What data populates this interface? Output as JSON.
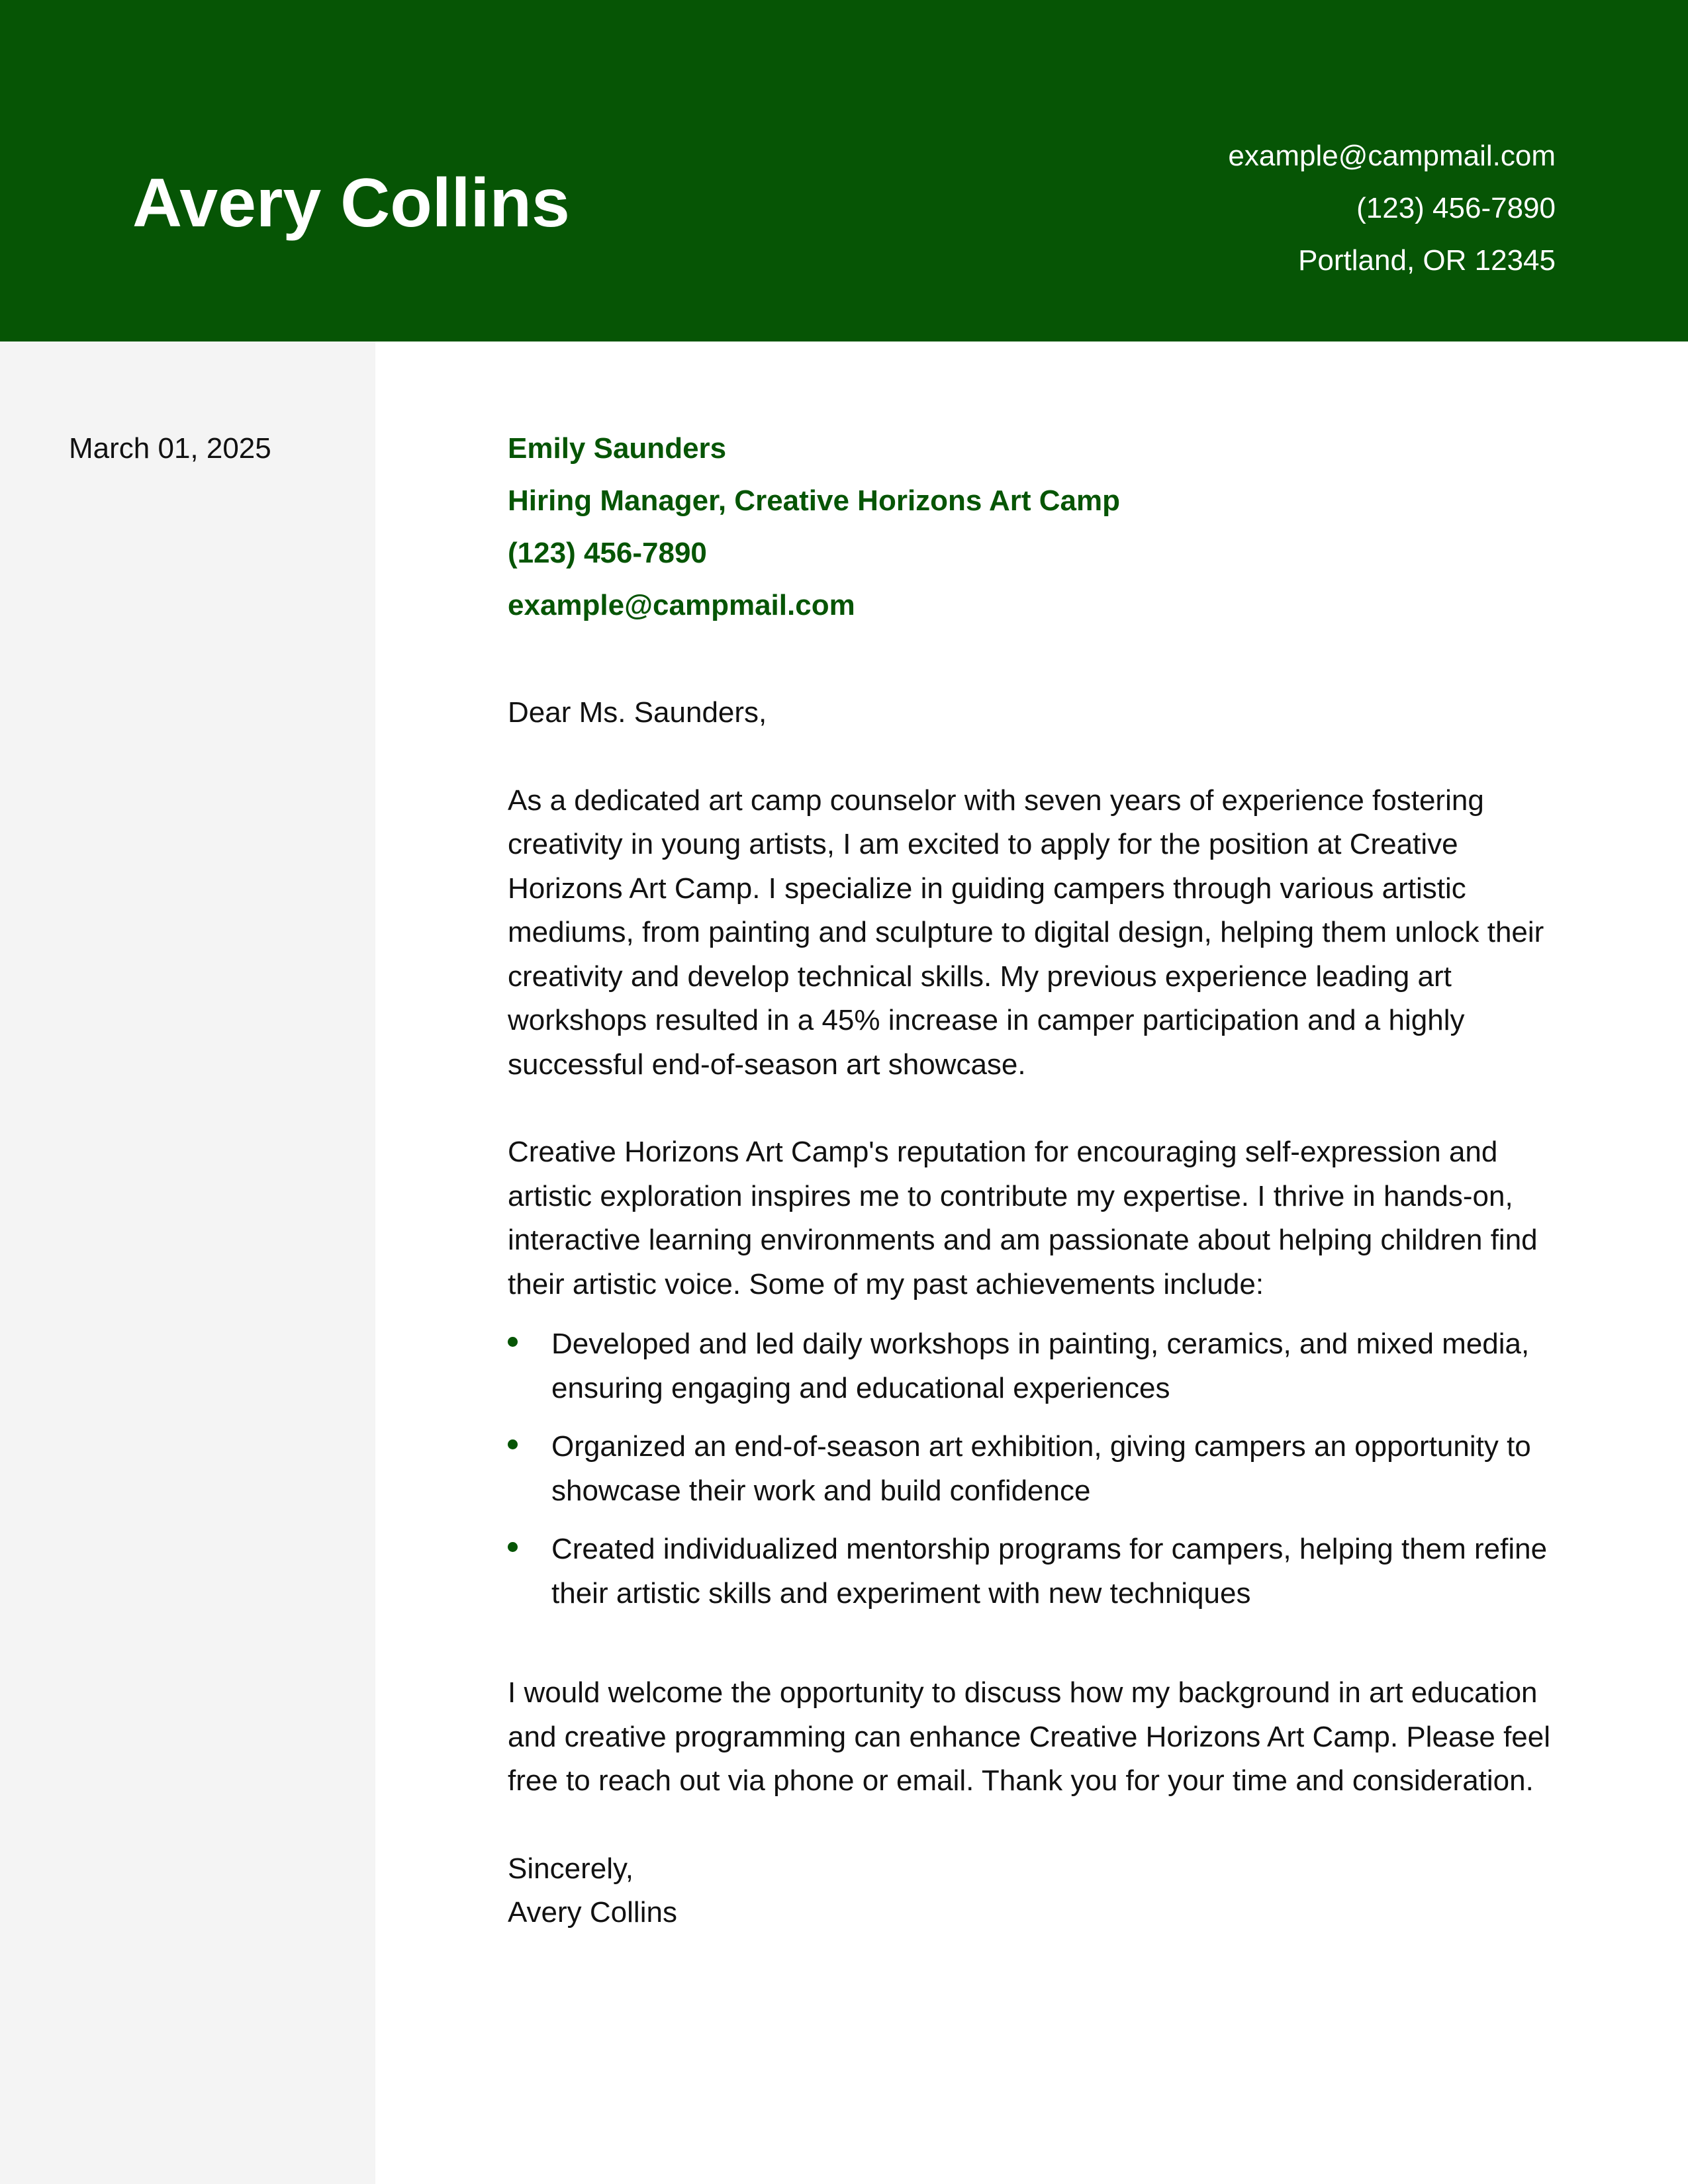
{
  "header": {
    "name": "Avery Collins",
    "contact": {
      "email": "example@campmail.com",
      "phone": "(123) 456-7890",
      "location": "Portland, OR 12345"
    }
  },
  "sidebar": {
    "date": "March 01, 2025"
  },
  "recipient": {
    "name": "Emily Saunders",
    "title": "Hiring Manager, Creative Horizons Art Camp",
    "phone": "(123) 456-7890",
    "email": "example@campmail.com"
  },
  "letter": {
    "greeting": "Dear Ms. Saunders,",
    "paragraph1": "As a dedicated art camp counselor with seven years of experience fostering creativity in young artists, I am excited to apply for the position at Creative Horizons Art Camp. I specialize in guiding campers through various artistic mediums, from painting and sculpture to digital design, helping them unlock their creativity and develop technical skills. My previous experience leading art workshops resulted in a 45% increase in camper participation and a highly successful end-of-season art showcase.",
    "paragraph2": "Creative Horizons Art Camp's reputation for encouraging self-expression and artistic exploration inspires me to contribute my expertise. I thrive in hands-on, interactive learning environments and am passionate about helping children find their artistic voice. Some of my past achievements include:",
    "achievements": [
      "Developed and led daily workshops in painting, ceramics, and mixed media, ensuring engaging and educational experiences",
      "Organized an end-of-season art exhibition, giving campers an opportunity to showcase their work and build confidence",
      "Created individualized mentorship programs for campers, helping them refine their artistic skills and experiment with new techniques"
    ],
    "paragraph3": "I would welcome the opportunity to discuss how my background in art education and creative programming can enhance Creative Horizons Art Camp. Please feel free to reach out via phone or email. Thank you for your time and consideration.",
    "closing": "Sincerely,",
    "signature": "Avery Collins"
  },
  "colors": {
    "accent": "#065505",
    "sidebar_bg": "#f4f4f4",
    "text": "#111111"
  }
}
